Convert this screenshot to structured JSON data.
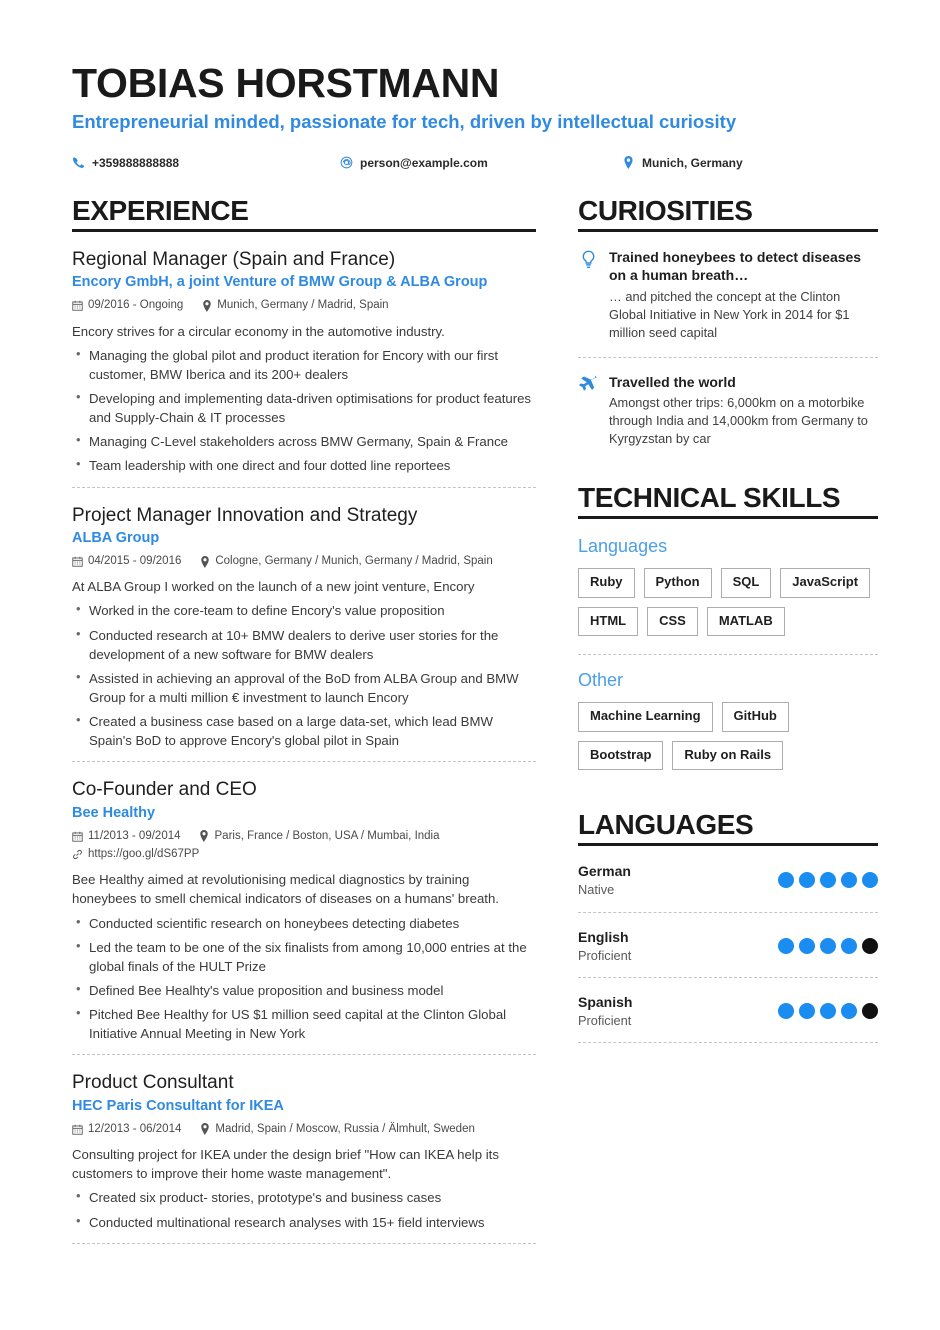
{
  "header": {
    "name": "TOBIAS HORSTMANN",
    "headline": "Entrepreneurial minded, passionate for tech, driven by intellectual curiosity",
    "contacts": [
      {
        "icon": "phone-icon",
        "text": "+359888888888"
      },
      {
        "icon": "email-icon",
        "text": "person@example.com"
      },
      {
        "icon": "location-pin-icon",
        "text": "Munich, Germany"
      }
    ]
  },
  "accent_color": "#2f8ae0",
  "dot_active_color": "#1b8cf0",
  "dot_inactive_color": "#111111",
  "experience": {
    "title": "EXPERIENCE",
    "entries": [
      {
        "role": "Regional Manager (Spain and France)",
        "organization": "Encory GmbH, a joint Venture of BMW Group & ALBA Group",
        "dates": "09/2016 - Ongoing",
        "location": "Munich, Germany / Madrid, Spain",
        "url": "",
        "summary": "Encory strives for a circular economy in the automotive industry.",
        "bullets": [
          "Managing the global pilot and product iteration for Encory with our first customer, BMW Iberica and its 200+ dealers",
          "Developing and implementing data-driven optimisations for product features and Supply-Chain & IT processes",
          "Managing C-Level stakeholders across BMW Germany, Spain & France",
          "Team leadership with one direct and four dotted line reportees"
        ]
      },
      {
        "role": "Project Manager Innovation and Strategy",
        "organization": "ALBA Group",
        "dates": "04/2015 - 09/2016",
        "location": "Cologne, Germany / Munich, Germany / Madrid, Spain",
        "url": "",
        "summary": "At ALBA Group I worked on the launch of a new joint venture, Encory",
        "bullets": [
          "Worked in the core-team to define Encory's value proposition",
          "Conducted research at 10+ BMW dealers to derive user stories for the development of a new software for BMW dealers",
          "Assisted in achieving an approval of the BoD from ALBA Group and BMW Group for a multi million € investment to launch Encory",
          "Created a business case based on a large data-set, which lead BMW Spain's BoD to approve Encory's global pilot in Spain"
        ]
      },
      {
        "role": "Co-Founder and CEO",
        "organization": "Bee Healthy",
        "dates": "11/2013 - 09/2014",
        "location": "Paris, France / Boston, USA / Mumbai, India",
        "url": "https://goo.gl/dS67PP",
        "summary": "Bee Healthy aimed at revolutionising medical diagnostics by training honeybees to smell chemical indicators of diseases on a humans' breath.",
        "bullets": [
          "Conducted scientific research on honeybees detecting diabetes",
          "Led the team to be one of the six finalists from among 10,000 entries at the global finals of the HULT Prize",
          "Defined Bee Healhty's value proposition and business model",
          "Pitched Bee Healthy for US $1 million seed capital at the Clinton Global Initiative Annual Meeting in New York"
        ]
      },
      {
        "role": "Product Consultant",
        "organization": "HEC Paris Consultant for IKEA",
        "dates": "12/2013 - 06/2014",
        "location": "Madrid, Spain / Moscow, Russia / Älmhult, Sweden",
        "url": "",
        "summary": "Consulting project for IKEA under the design brief \"How can IKEA help its customers to improve their home waste management\".",
        "bullets": [
          "Created six product- stories, prototype's and business cases",
          "Conducted multinational research analyses with 15+ field interviews"
        ]
      }
    ]
  },
  "curiosities": {
    "title": "CURIOSITIES",
    "items": [
      {
        "icon": "lightbulb-icon",
        "title": "Trained honeybees to detect diseases on a human breath…",
        "description": "… and pitched the concept at the Clinton Global Initiative in New York in 2014 for $1 million seed capital"
      },
      {
        "icon": "airplane-icon",
        "title": "Travelled the world",
        "description": "Amongst other trips: 6,000km on a motorbike through India and 14,000km from Germany to Kyrgyzstan by car"
      }
    ]
  },
  "technical_skills": {
    "title": "TECHNICAL SKILLS",
    "groups": [
      {
        "name": "Languages",
        "tags": [
          "Ruby",
          "Python",
          "SQL",
          "JavaScript",
          "HTML",
          "CSS",
          "MATLAB"
        ]
      },
      {
        "name": "Other",
        "tags": [
          "Machine Learning",
          "GitHub",
          "Bootstrap",
          "Ruby on Rails"
        ]
      }
    ]
  },
  "languages": {
    "title": "LANGUAGES",
    "max_dots": 5,
    "items": [
      {
        "name": "German",
        "level": "Native",
        "filled": 5
      },
      {
        "name": "English",
        "level": "Proficient",
        "filled": 4
      },
      {
        "name": "Spanish",
        "level": "Proficient",
        "filled": 4
      }
    ]
  }
}
